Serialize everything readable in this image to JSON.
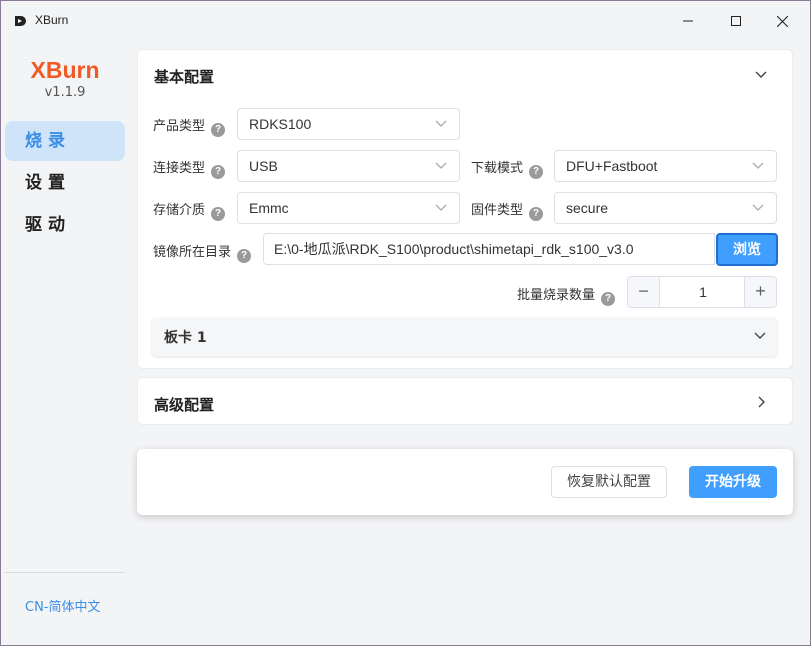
{
  "window": {
    "title": "XBurn"
  },
  "sidebar": {
    "logo": "XBurn",
    "version": "v1.1.9",
    "items": [
      {
        "label": "烧录",
        "active": true
      },
      {
        "label": "设置",
        "active": false
      },
      {
        "label": "驱动",
        "active": false
      }
    ],
    "language": "CN-简体中文"
  },
  "basic": {
    "title": "基本配置",
    "product_type": {
      "label": "产品类型",
      "value": "RDKS100"
    },
    "connect_type": {
      "label": "连接类型",
      "value": "USB"
    },
    "download_mode": {
      "label": "下载模式",
      "value": "DFU+Fastboot"
    },
    "storage": {
      "label": "存储介质",
      "value": "Emmc"
    },
    "firmware_type": {
      "label": "固件类型",
      "value": "secure"
    },
    "image_dir": {
      "label": "镜像所在目录",
      "value": "E:\\0-地瓜派\\RDK_S100\\product\\shimetapi_rdk_s100_v3.0",
      "browse_label": "浏览"
    },
    "batch_count": {
      "label": "批量烧录数量",
      "value": "1",
      "minus": "−",
      "plus": "+"
    },
    "board": {
      "title": "板卡 1"
    }
  },
  "advanced": {
    "title": "高级配置"
  },
  "footer": {
    "reset_label": "恢复默认配置",
    "start_label": "开始升级"
  },
  "help_glyph": "?",
  "colors": {
    "accent": "#409eff",
    "brand": "#f05a24",
    "nav_active_bg": "#cfe3f9"
  }
}
